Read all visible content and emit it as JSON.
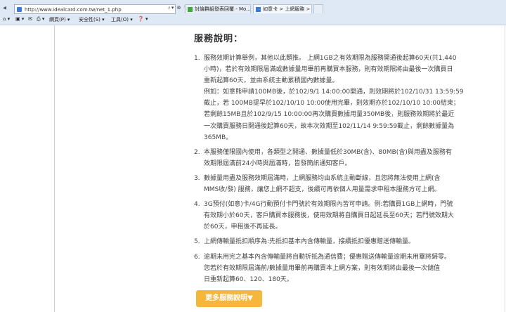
{
  "browser": {
    "url": "http://www.idealcard.com.tw/net_1.php",
    "tabs": [
      {
        "label": "討論群組發表回覆 - Mo..."
      },
      {
        "label": "如意卡 > 上網服務 > ..."
      }
    ],
    "toolbar": {
      "page_menu": "網頁(P) ▾",
      "safety_menu": "安全性(S) ▾",
      "tools_menu": "工具(O) ▾",
      "help_icon": "❓ ▾"
    }
  },
  "section": {
    "title": "服務說明："
  },
  "items": [
    {
      "num": "1.",
      "lines": [
        "服務效期計算舉例，其他以此類推。 上網1GB之有效期限為服務開通後起算60天(共1,440",
        "小時)，若於有效期限屆滿或數據量用畢前再購買本服務，則有效期限將由最後一次購買日",
        "重新起算60天，並由系統主動累積國內數據量。",
        "例如：如意熊申請100MB後，於102/9/1 14:00:00開通，則效期將於102/10/31 13:59:59",
        "截止，若 100MB提早於102/10/10 10:00使用完畢，則效期亦於102/10/10 10:00結束；",
        "若剩餘15MB且於102/9/15 10:00:00再次購買數據用量350MB後，則服務效期將於最近",
        "一次購買服務日開通後起算60天，故本次效期至102/11/14 9:59:59截止，剩餘數據量為",
        "365MB。"
      ]
    },
    {
      "num": "2.",
      "lines": [
        "本服務僅限國內使用，各類型之開通、數據量低於30MB(含)、80MB(含)與用盡及服務有",
        "效期限屆滿前24小時與屆滿時，皆發簡訊通知客戶。"
      ]
    },
    {
      "num": "3.",
      "lines": [
        "數據量用盡及服務效期屆滿時，上網服務均由系統主動斷線，且您將無法使用上網(含",
        "MMS收/發) 服務，讓您上網不超支，後續可再依個人用量需求申租本服務方可上網。"
      ]
    },
    {
      "num": "4.",
      "lines": [
        "3G預付(如意)卡/4G行動預付卡門號於有效期限內皆可申請。例:若購買1GB上網時，門號",
        "有效期小於60天，客戶購買本服務後，使用效期將自購買日起延長至60天；若門號效期大",
        "於60天，申租後不再延長。"
      ]
    },
    {
      "num": "5.",
      "lines": [
        "上網傳輸量抵扣順序為:先抵扣基本內含傳輸量，接續抵扣優惠贈送傳輸量。"
      ]
    },
    {
      "num": "6.",
      "lines": [
        "逾期未用完之基本內含傳輸量將自動折抵為通信費；優惠贈送傳輸量逾期未用畢將歸零。",
        "您若於有效期限屆滿前/數據量用畢前再購買本上網方案，則有效期將由最後一次儲值",
        "日重新起算60、120、180天。"
      ]
    }
  ],
  "more_button": {
    "label": "更多服務說明▼"
  },
  "colors": {
    "accent": "#f5b63c",
    "text": "#444444"
  }
}
